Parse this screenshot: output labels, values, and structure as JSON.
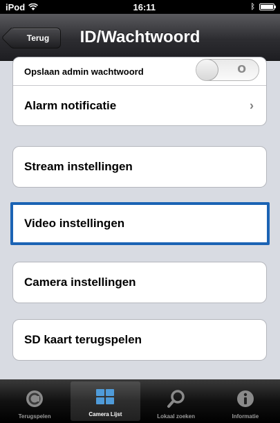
{
  "status_bar": {
    "carrier": "iPod",
    "time": "16:11"
  },
  "nav": {
    "back_label": "Terug",
    "title": "ID/Wachtwoord"
  },
  "groups": [
    {
      "cells": [
        {
          "label": "Opslaan admin wachtwoord",
          "toggle_label": "O",
          "toggle_on": false
        },
        {
          "label": "Alarm notificatie",
          "chevron": "›"
        }
      ]
    },
    {
      "cells": [
        {
          "label": "Stream instellingen"
        }
      ]
    },
    {
      "cells": [
        {
          "label": "Video instellingen"
        }
      ]
    },
    {
      "cells": [
        {
          "label": "Camera instellingen"
        }
      ]
    },
    {
      "cells": [
        {
          "label": "SD kaart terugspelen"
        }
      ]
    }
  ],
  "tabs": [
    {
      "label": "Terugspelen",
      "icon": "playback-icon",
      "active": false
    },
    {
      "label": "Camera Lijst",
      "icon": "camera-list-icon",
      "active": true
    },
    {
      "label": "Lokaal zoeken",
      "icon": "search-icon",
      "active": false
    },
    {
      "label": "Informatie",
      "icon": "info-icon",
      "active": false
    }
  ],
  "colors": {
    "selection_outline": "#1b63b4",
    "background": "#d8dbe2"
  }
}
